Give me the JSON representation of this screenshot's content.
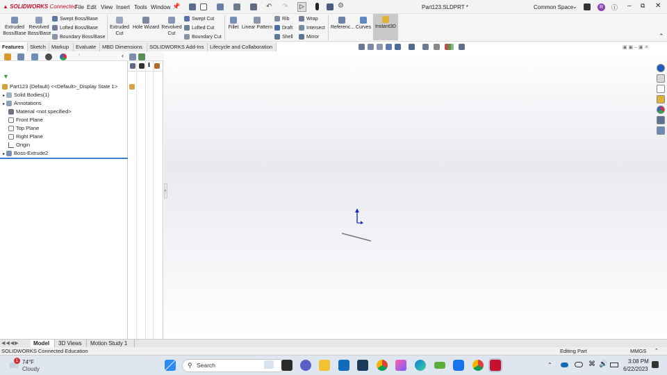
{
  "title_bar": {
    "logo_brand": "SOLIDWORKS",
    "logo_suffix": "Connected",
    "menu": [
      "File",
      "Edit",
      "View",
      "Insert",
      "Tools",
      "Window"
    ],
    "document_title": "Part123.SLDPRT *",
    "workspace": "Common Space",
    "user_initial": "R"
  },
  "ribbon": {
    "extruded_boss": "Extruded Boss/Base",
    "revolved_boss": "Revolved Boss/Base",
    "swept_boss": "Swept Boss/Base",
    "lofted_boss": "Lofted Boss/Base",
    "boundary_boss": "Boundary Boss/Base",
    "extruded_cut": "Extruded Cut",
    "hole_wizard": "Hole Wizard",
    "revolved_cut": "Revolved Cut",
    "swept_cut": "Swept Cut",
    "lofted_cut": "Lofted Cut",
    "boundary_cut": "Boundary Cut",
    "fillet": "Fillet",
    "linear_pattern": "Linear Pattern",
    "rib": "Rib",
    "draft": "Draft",
    "shell": "Shell",
    "wrap": "Wrap",
    "intersect": "Intersect",
    "mirror": "Mirror",
    "reference": "Referenc...",
    "curves": "Curves",
    "instant3d": "Instant3D"
  },
  "command_tabs": [
    "Features",
    "Sketch",
    "Markup",
    "Evaluate",
    "MBD Dimensions",
    "SOLIDWORKS Add-Ins",
    "Lifecycle and Collaboration"
  ],
  "feature_tree": {
    "root": "Part123 (Default) <<Default>_Display State 1>",
    "items": [
      "Solid Bodies(1)",
      "Annotations",
      "Material <not specified>",
      "Front Plane",
      "Top Plane",
      "Right Plane",
      "Origin",
      "Boss-Extrude2"
    ]
  },
  "bottom_tabs": [
    "Model",
    "3D Views",
    "Motion Study 1"
  ],
  "status": {
    "left": "SOLIDWORKS Connected Education",
    "mode": "Editing Part",
    "units": "MMGS"
  },
  "taskbar": {
    "temperature": "74°F",
    "weather": "Cloudy",
    "weather_badge": "1",
    "search": "Search",
    "time": "3:08 PM",
    "date": "6/22/2023"
  }
}
